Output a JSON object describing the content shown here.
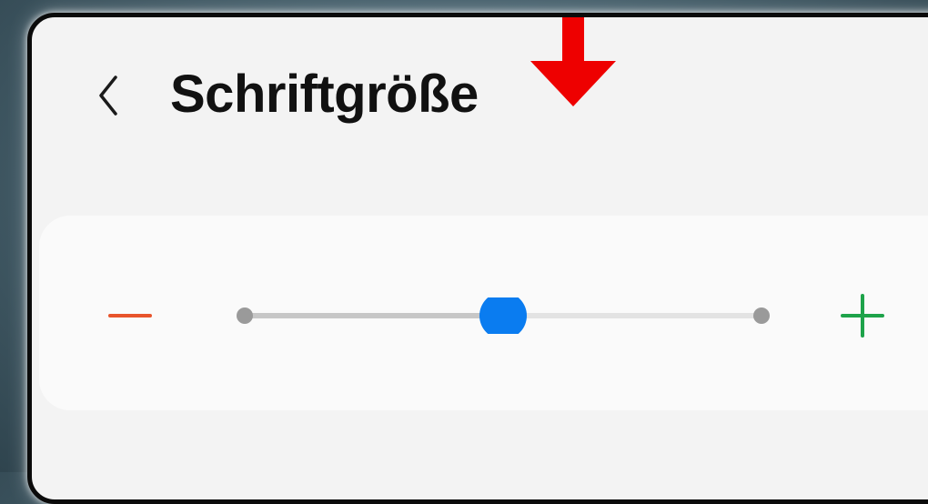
{
  "header": {
    "title": "Schriftgröße",
    "back_icon": "chevron-left-icon"
  },
  "annotation": {
    "icon": "arrow-down-icon",
    "color": "#ee0000"
  },
  "font_size_slider": {
    "minus_icon": "minus-icon",
    "plus_icon": "plus-icon",
    "level_fraction": 0.5,
    "colors": {
      "minus": "#e8542c",
      "plus": "#1ea34a",
      "thumb": "#0a7cf0",
      "track_filled": "#c7c7c7",
      "track_empty": "#e3e3e3",
      "endpoint": "#9a9a9a"
    }
  }
}
